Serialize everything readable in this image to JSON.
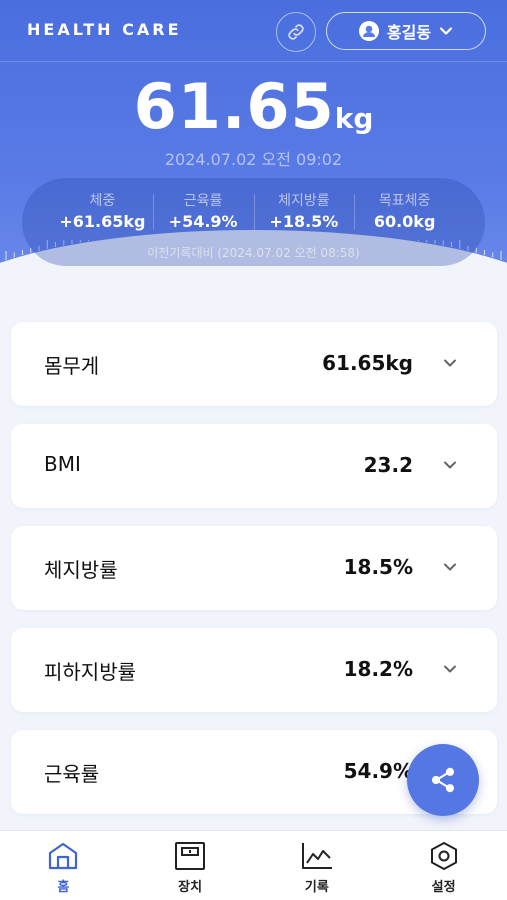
{
  "app": {
    "brand": "HEALTH CARE",
    "user_name": "홍길동"
  },
  "summary": {
    "weight_value": "61.65",
    "weight_unit": "kg",
    "datetime": "2024.07.02 오전 09:02",
    "stats": [
      {
        "label": "체중",
        "value": "+61.65kg"
      },
      {
        "label": "근육률",
        "value": "+54.9%"
      },
      {
        "label": "체지방률",
        "value": "+18.5%"
      },
      {
        "label": "목표체중",
        "value": "60.0kg"
      }
    ],
    "compare_text": "이전기록대비 (2024.07.02 오전 08:58)"
  },
  "metrics": [
    {
      "name": "몸무게",
      "value": "61.65kg"
    },
    {
      "name": "BMI",
      "value": "23.2"
    },
    {
      "name": "체지방률",
      "value": "18.5%"
    },
    {
      "name": "피하지방률",
      "value": "18.2%"
    },
    {
      "name": "근육률",
      "value": "54.9%"
    }
  ],
  "nav": [
    {
      "label": "홈",
      "icon": "home-icon",
      "active": true
    },
    {
      "label": "장치",
      "icon": "scale-icon",
      "active": false
    },
    {
      "label": "기록",
      "icon": "chart-icon",
      "active": false
    },
    {
      "label": "설정",
      "icon": "settings-icon",
      "active": false
    }
  ],
  "colors": {
    "primary": "#4a6ede",
    "fab": "#5577e3",
    "active_nav": "#3f63d8",
    "background": "#f1f4fb"
  }
}
